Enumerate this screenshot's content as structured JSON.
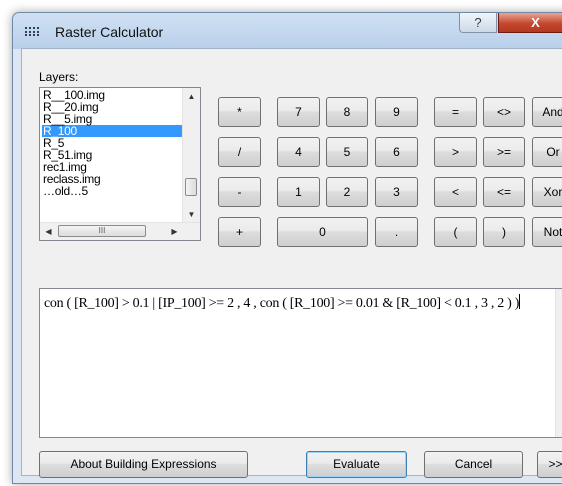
{
  "window": {
    "title": "Raster Calculator"
  },
  "titlebar_buttons": {
    "help": "?",
    "close": "X"
  },
  "layers": {
    "label": "Layers:",
    "items": [
      "R__100.img",
      "R__20.img",
      "R__5.img",
      "R_100",
      "R_5",
      "R_51.img",
      "rec1.img",
      "reclass.img",
      "…old…5"
    ],
    "selected_index": 3,
    "hscroll_thumb": "III"
  },
  "keypad": {
    "row1": [
      "*",
      "7",
      "8",
      "9",
      "=",
      "<>",
      "And"
    ],
    "row2": [
      "/",
      "4",
      "5",
      "6",
      ">",
      ">=",
      "Or"
    ],
    "row3": [
      "-",
      "1",
      "2",
      "3",
      "<",
      "<=",
      "Xor"
    ],
    "row4": [
      "+",
      "0",
      ".",
      "(",
      ")",
      "Not"
    ]
  },
  "expression": {
    "text": "con ( [R_100] > 0.1 | [IP_100] >= 2 , 4 , con ( [R_100] >= 0.01 & [R_100] < 0.1 , 3 , 2 ) )"
  },
  "footer": {
    "about": "About Building Expressions",
    "evaluate": "Evaluate",
    "cancel": "Cancel",
    "more": ">>"
  },
  "colors": {
    "selection": "#3399ff",
    "frame": "#dde7f3",
    "close": "#c5482e"
  }
}
